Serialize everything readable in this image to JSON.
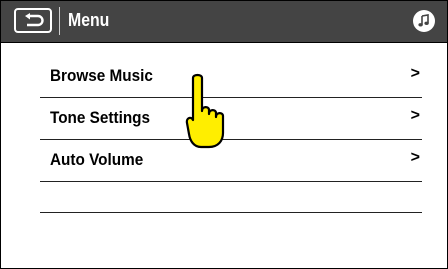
{
  "header": {
    "title": "Menu",
    "back_icon": "return-arrow-icon",
    "music_icon": "music-note-icon",
    "background_color": "#444444"
  },
  "menu": {
    "items": [
      {
        "label": "Browse Music",
        "chevron": ">"
      },
      {
        "label": "Tone Settings",
        "chevron": ">"
      },
      {
        "label": "Auto Volume",
        "chevron": ">"
      }
    ]
  },
  "pointer": {
    "icon": "hand-pointer-icon",
    "color": "#ffee00"
  }
}
